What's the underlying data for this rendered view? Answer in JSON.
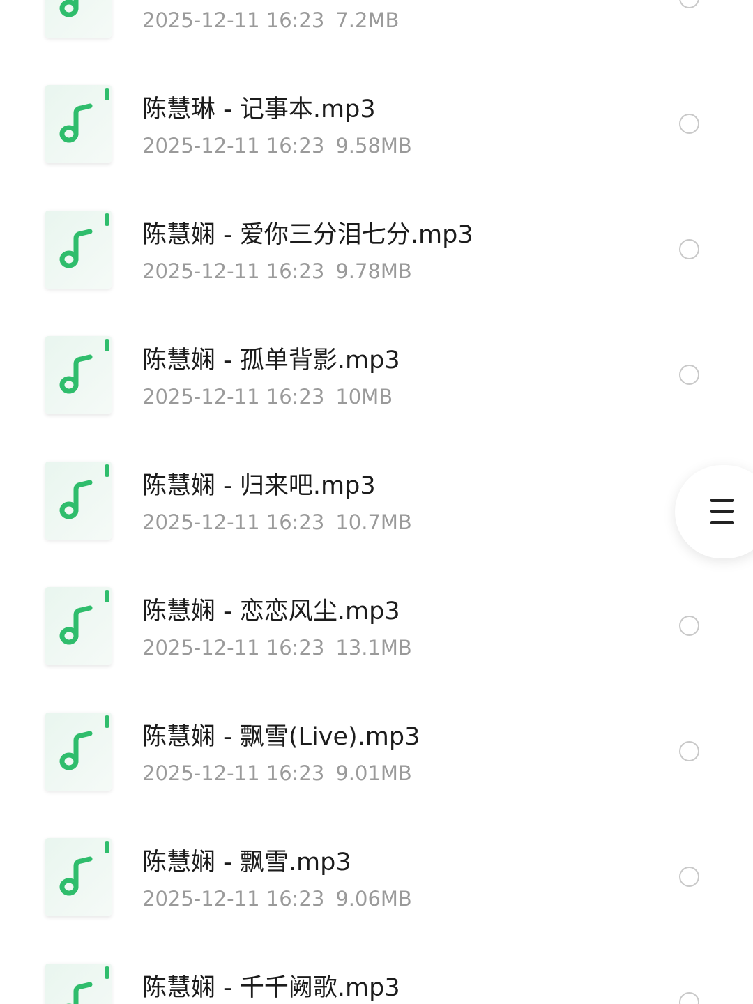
{
  "files": [
    {
      "title": "",
      "date": "2025-12-11 16:23",
      "size": "7.2MB"
    },
    {
      "title": "陈慧琳 - 记事本.mp3",
      "date": "2025-12-11 16:23",
      "size": "9.58MB"
    },
    {
      "title": "陈慧娴 - 爱你三分泪七分.mp3",
      "date": "2025-12-11 16:23",
      "size": "9.78MB"
    },
    {
      "title": "陈慧娴 - 孤单背影.mp3",
      "date": "2025-12-11 16:23",
      "size": "10MB"
    },
    {
      "title": "陈慧娴 - 归来吧.mp3",
      "date": "2025-12-11 16:23",
      "size": "10.7MB"
    },
    {
      "title": "陈慧娴 - 恋恋风尘.mp3",
      "date": "2025-12-11 16:23",
      "size": "13.1MB"
    },
    {
      "title": "陈慧娴 - 飘雪(Live).mp3",
      "date": "2025-12-11 16:23",
      "size": "9.01MB"
    },
    {
      "title": "陈慧娴 - 飘雪.mp3",
      "date": "2025-12-11 16:23",
      "size": "9.06MB"
    },
    {
      "title": "陈慧娴 - 千千阙歌.mp3",
      "date": "",
      "size": ""
    }
  ],
  "icons": {
    "file_icon": "music-note-icon",
    "select": "radio-circle-icon",
    "menu": "hamburger-menu-icon"
  },
  "colors": {
    "accent": "#2fbd6c",
    "title_text": "#1c1c1c",
    "meta_text": "#9a9a9a",
    "radio_border": "#c9c9c9"
  }
}
